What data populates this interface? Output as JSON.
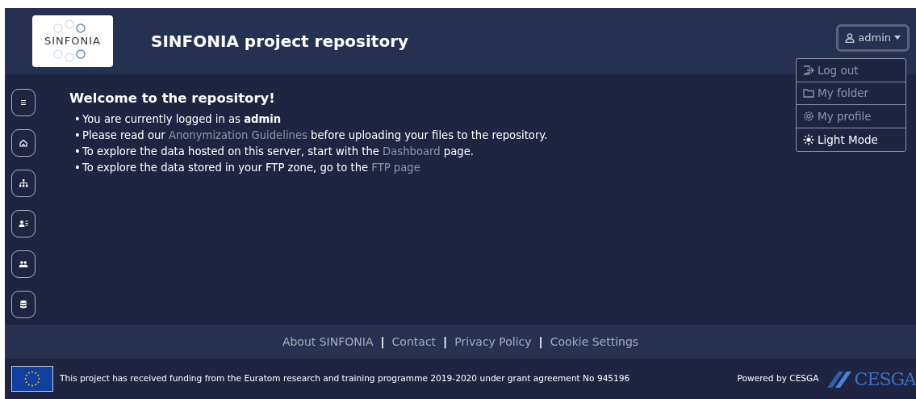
{
  "header": {
    "logo_text": "SINFONIA",
    "title": "SINFONIA project repository"
  },
  "user_menu": {
    "label": "admin",
    "expanded": true,
    "items": [
      {
        "kind": "logout",
        "label": "Log out",
        "disabled": true
      },
      {
        "kind": "folder",
        "label": "My folder",
        "disabled": true
      },
      {
        "kind": "profile",
        "label": "My profile",
        "disabled": true
      },
      {
        "kind": "theme",
        "label": "Light Mode",
        "disabled": false
      }
    ]
  },
  "welcome": {
    "heading": "Welcome to the repository!",
    "bullet_marker": "•",
    "bullets": [
      {
        "parts": [
          {
            "kind": "text",
            "text": "You are currently logged in as **admin**"
          }
        ]
      },
      {
        "parts": [
          {
            "kind": "text",
            "text": "Please read our "
          },
          {
            "kind": "link",
            "text": "Anonymization Guidelines"
          },
          {
            "kind": "text",
            "text": " before uploading your files to the repository."
          }
        ]
      },
      {
        "parts": [
          {
            "kind": "text",
            "text": "To explore the data hosted on this server, start with the "
          },
          {
            "kind": "link",
            "text": "Dashboard"
          },
          {
            "kind": "text",
            "text": " page."
          }
        ]
      },
      {
        "parts": [
          {
            "kind": "text",
            "text": "To explore the data stored in your FTP zone, go to the "
          },
          {
            "kind": "link",
            "text": "FTP page"
          }
        ]
      }
    ]
  },
  "footer_links": [
    "About SINFONIA",
    "Contact",
    "Privacy Policy",
    "Cookie Settings"
  ],
  "footer_separator": "|",
  "funding_text": "This project has received funding from the Euratom research and training programme 2019-2020 under grant agreement No 945196",
  "powered_by": "Powered by CESGA",
  "partner_logo_text": "CESGA"
}
